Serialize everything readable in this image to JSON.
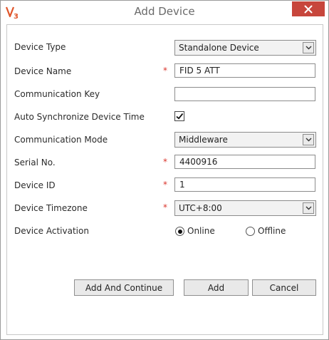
{
  "window": {
    "title": "Add Device",
    "logo_text": "V3",
    "close_icon": "close-icon"
  },
  "form": {
    "device_type": {
      "label": "Device Type",
      "value": "Standalone Device"
    },
    "device_name": {
      "label": "Device Name",
      "value": "FID 5 ATT",
      "required": "*"
    },
    "communication_key": {
      "label": "Communication Key",
      "value": ""
    },
    "auto_sync": {
      "label": "Auto Synchronize Device Time",
      "checked": true
    },
    "communication_mode": {
      "label": "Communication Mode",
      "value": "Middleware"
    },
    "serial_no": {
      "label": "Serial No.",
      "value": "4400916",
      "required": "*"
    },
    "device_id": {
      "label": "Device ID",
      "value": "1",
      "required": "*"
    },
    "device_timezone": {
      "label": "Device Timezone",
      "value": "UTC+8:00",
      "required": "*"
    },
    "device_activation": {
      "label": "Device Activation",
      "options": [
        "Online",
        "Offline"
      ],
      "selected": "Online"
    }
  },
  "buttons": {
    "add_continue": "Add And Continue",
    "add": "Add",
    "cancel": "Cancel"
  },
  "colors": {
    "close_bg": "#c7463c",
    "required": "#d9342b",
    "logo": "#e0552a"
  }
}
